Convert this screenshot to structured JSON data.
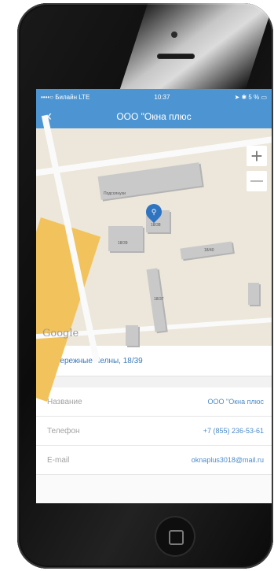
{
  "status_bar": {
    "carrier": "••••○ Билайн LTE",
    "time": "10:37",
    "battery": "5 %"
  },
  "nav": {
    "back_icon": "chevron-left-icon",
    "title": "ООО \"Окна плюс"
  },
  "map": {
    "zoom_in": "+",
    "zoom_out": "—",
    "labels": {
      "area": "Подсолнухи",
      "b1": "18/39",
      "b2": "18/38",
      "b3": "18/40",
      "b4": "18/37"
    },
    "attribution": "Google"
  },
  "address": "Набережные Челны, 18/39",
  "details": [
    {
      "label": "Название",
      "value": "ООО \"Окна плюс"
    },
    {
      "label": "Телефон",
      "value": "+7 (855) 236-53-61"
    },
    {
      "label": "E-mail",
      "value": "oknaplus3018@mail.ru"
    }
  ],
  "colors": {
    "accent": "#4d95d2",
    "link": "#4d8bc8"
  }
}
